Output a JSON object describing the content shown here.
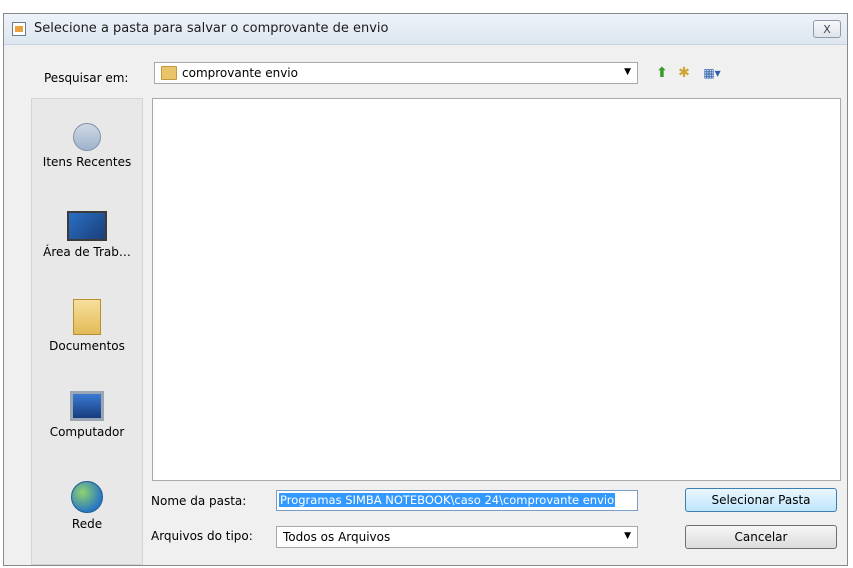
{
  "window": {
    "title": "Selecione a pasta para salvar o comprovante de envio",
    "close_glyph": "X"
  },
  "toolbar": {
    "look_in_label": "Pesquisar em:",
    "look_in_value": "comprovante envio",
    "icons": [
      "folder-icon",
      "up-folder-icon",
      "new-folder-icon",
      "view-menu-icon"
    ]
  },
  "places": [
    {
      "label": "Itens Recentes",
      "icon": "recent-items-icon"
    },
    {
      "label": "Área de Trab…",
      "icon": "desktop-icon"
    },
    {
      "label": "Documentos",
      "icon": "documents-icon"
    },
    {
      "label": "Computador",
      "icon": "computer-icon"
    },
    {
      "label": "Rede",
      "icon": "network-icon"
    }
  ],
  "form": {
    "folder_name_label": "Nome da pasta:",
    "folder_name_value": "Programas SIMBA NOTEBOOK\\caso 24\\comprovante envio",
    "file_type_label": "Arquivos do tipo:",
    "file_type_value": "Todos os Arquivos"
  },
  "buttons": {
    "select": "Selecionar Pasta",
    "cancel": "Cancelar"
  }
}
